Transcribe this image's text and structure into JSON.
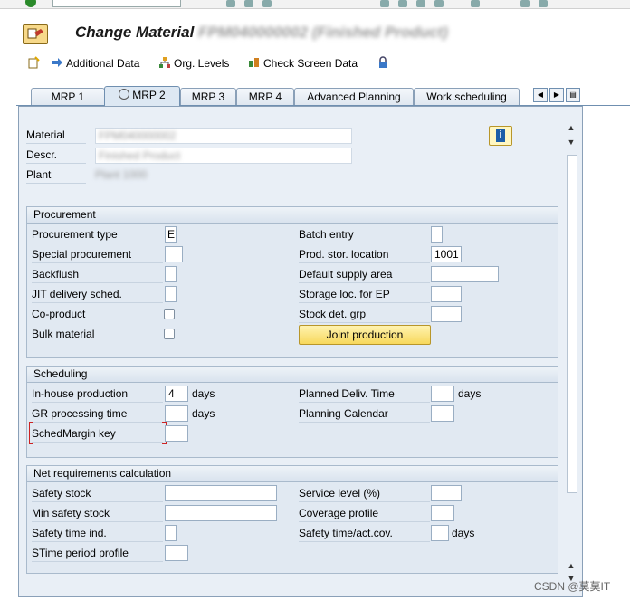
{
  "window": {
    "title": "Change Material",
    "title_suffix_blurred": "FPM040000002 (Finished Product)"
  },
  "toolbar": {
    "additional_data": "Additional Data",
    "org_levels": "Org. Levels",
    "check_screen_data": "Check Screen Data"
  },
  "tabs": [
    {
      "label": "MRP 1"
    },
    {
      "label": "MRP 2"
    },
    {
      "label": "MRP 3"
    },
    {
      "label": "MRP 4"
    },
    {
      "label": "Advanced Planning"
    },
    {
      "label": "Work scheduling"
    }
  ],
  "header": {
    "material_label": "Material",
    "descr_label": "Descr.",
    "plant_label": "Plant",
    "material_value_blurred": "FPM040000002",
    "descr_value_blurred": "Finished Product",
    "plant_value_blurred": "Plant 1000"
  },
  "procurement": {
    "title": "Procurement",
    "procurement_type_label": "Procurement type",
    "procurement_type_value": "E",
    "special_procurement_label": "Special procurement",
    "backflush_label": "Backflush",
    "jit_label": "JIT delivery sched.",
    "co_product_label": "Co-product",
    "bulk_material_label": "Bulk material",
    "batch_entry_label": "Batch entry",
    "prod_stor_location_label": "Prod. stor. location",
    "prod_stor_location_value": "1001",
    "default_supply_area_label": "Default supply area",
    "storage_loc_ep_label": "Storage loc. for EP",
    "stock_det_grp_label": "Stock det. grp",
    "joint_production_label": "Joint production"
  },
  "scheduling": {
    "title": "Scheduling",
    "inhouse_label": "In-house production",
    "inhouse_value": "4",
    "inhouse_unit": "days",
    "gr_processing_label": "GR processing time",
    "gr_processing_unit": "days",
    "schedmargin_label": "SchedMargin key",
    "planned_deliv_label": "Planned Deliv. Time",
    "planned_deliv_unit": "days",
    "planning_calendar_label": "Planning Calendar"
  },
  "net_requirements": {
    "title": "Net requirements calculation",
    "safety_stock_label": "Safety stock",
    "min_safety_stock_label": "Min safety stock",
    "safety_time_ind_label": "Safety time ind.",
    "stime_period_profile_label": "STime period profile",
    "service_level_label": "Service level (%)",
    "coverage_profile_label": "Coverage profile",
    "safety_time_cov_label": "Safety time/act.cov.",
    "safety_time_cov_unit": "days"
  },
  "watermark": "CSDN @莫莫IT",
  "colors": {
    "panel_bg": "#e9eff6",
    "group_bg": "#e1e9f2",
    "accent_button": "#f7d85c",
    "border": "#8aa0b8"
  }
}
